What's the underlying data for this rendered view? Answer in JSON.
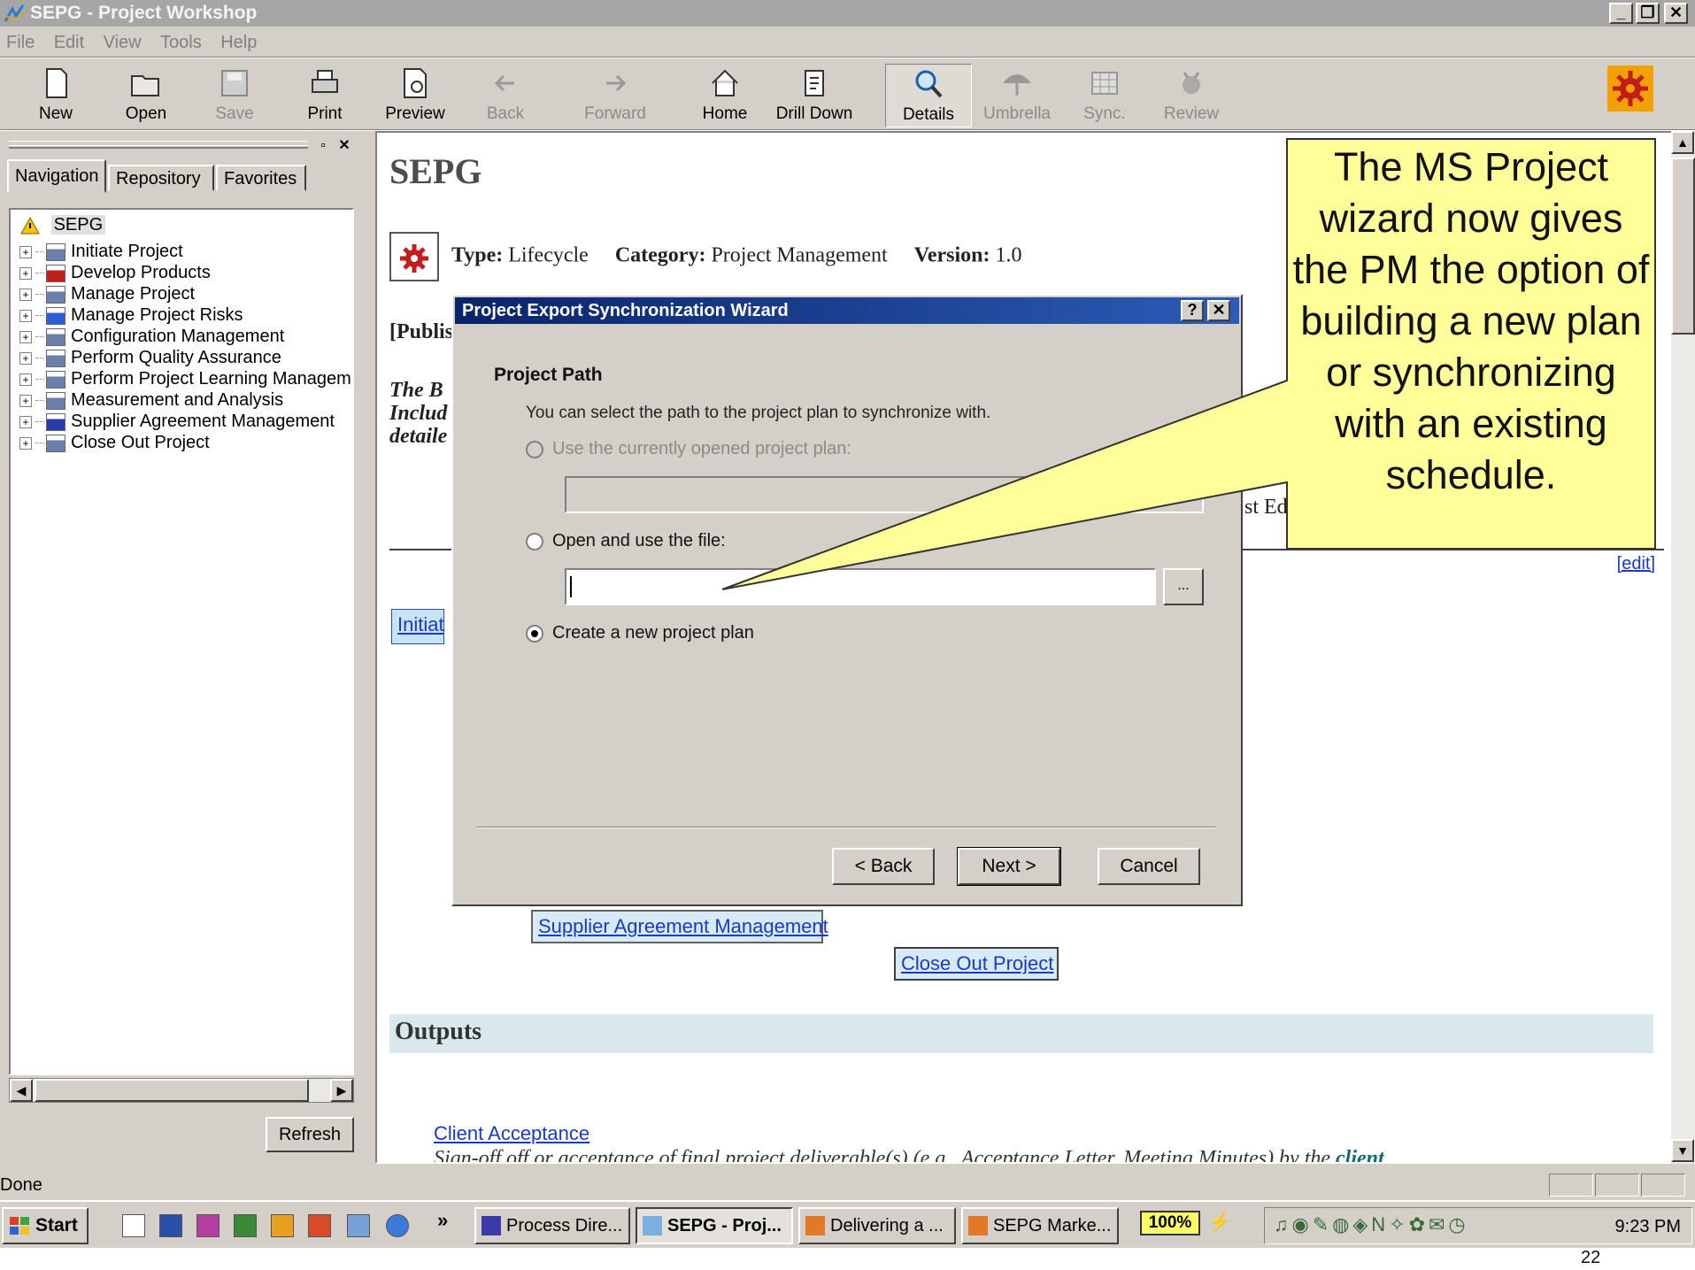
{
  "window": {
    "title": "SEPG - Project Workshop",
    "minimize": "_",
    "maximize": "❐",
    "close": "✕"
  },
  "menu": [
    "File",
    "Edit",
    "View",
    "Tools",
    "Help"
  ],
  "toolbar": {
    "new": "New",
    "open": "Open",
    "save": "Save",
    "print": "Print",
    "preview": "Preview",
    "back": "Back",
    "forward": "Forward",
    "home": "Home",
    "drill_down": "Drill Down",
    "details": "Details",
    "umbrella": "Umbrella",
    "sync": "Sync.",
    "review": "Review"
  },
  "left_pane": {
    "tabs": [
      "Navigation",
      "Repository",
      "Favorites"
    ],
    "root": "SEPG",
    "items": [
      {
        "label": "Initiate Project",
        "icon": "doc-icon"
      },
      {
        "label": "Develop Products",
        "icon": "gear-red-icon"
      },
      {
        "label": "Manage Project",
        "icon": "doc-icon"
      },
      {
        "label": "Manage Project Risks",
        "icon": "risk-icon"
      },
      {
        "label": "Configuration Management",
        "icon": "doc-icon"
      },
      {
        "label": "Perform Quality Assurance",
        "icon": "doc-icon"
      },
      {
        "label": "Perform Project Learning Managem",
        "icon": "doc-icon"
      },
      {
        "label": "Measurement and Analysis",
        "icon": "doc-icon"
      },
      {
        "label": "Supplier Agreement Management",
        "icon": "question-doc-icon"
      },
      {
        "label": "Close Out Project",
        "icon": "doc-icon"
      }
    ],
    "refresh": "Refresh",
    "plus": "+"
  },
  "content": {
    "heading": "SEPG",
    "type_label": "Type:",
    "type_value": "Lifecycle",
    "category_label": "Category:",
    "category_value": "Project Management",
    "version_label": "Version:",
    "version_value": "1.0",
    "published_fragment": "[Publis",
    "italic_line1": "The B",
    "italic_line2": "Includ",
    "italic_line3": "detaile",
    "right_fragment": "st Ed",
    "edit_link": "[edit]",
    "initiate_link": "Initiate",
    "supplier_link": "Supplier Agreement Management",
    "closeout_link": "Close Out Project",
    "outputs_heading": "Outputs",
    "client_link": "Client Acceptance",
    "client_desc": "Sign-off off or acceptance of final project deliverable(s) (e.g., Acceptance Letter, Meeting Minutes) by the ",
    "client_word": "client"
  },
  "dialog": {
    "title": "Project Export Synchronization Wizard",
    "help": "?",
    "close": "✕",
    "heading": "Project Path",
    "description": "You can select the path to the project plan to synchronize with.",
    "option_current": "Use the currently opened project plan:",
    "option_open": "Open and use the file:",
    "option_new": "Create a new project plan",
    "browse": "...",
    "back": "< Back",
    "next": "Next >",
    "cancel": "Cancel"
  },
  "callout": {
    "text": "The MS Project wizard now gives the PM the option of building a new plan or synchronizing with an existing schedule.",
    "fill": "#ffff99"
  },
  "status": {
    "text": "Done"
  },
  "taskbar": {
    "start": "Start",
    "chevron": "»",
    "tasks": [
      "Process Dire...",
      "SEPG - Proj...",
      "Delivering a ...",
      "SEPG Marke..."
    ],
    "zoom": "100%",
    "clock": "9:23 PM"
  },
  "slide_number": "22"
}
